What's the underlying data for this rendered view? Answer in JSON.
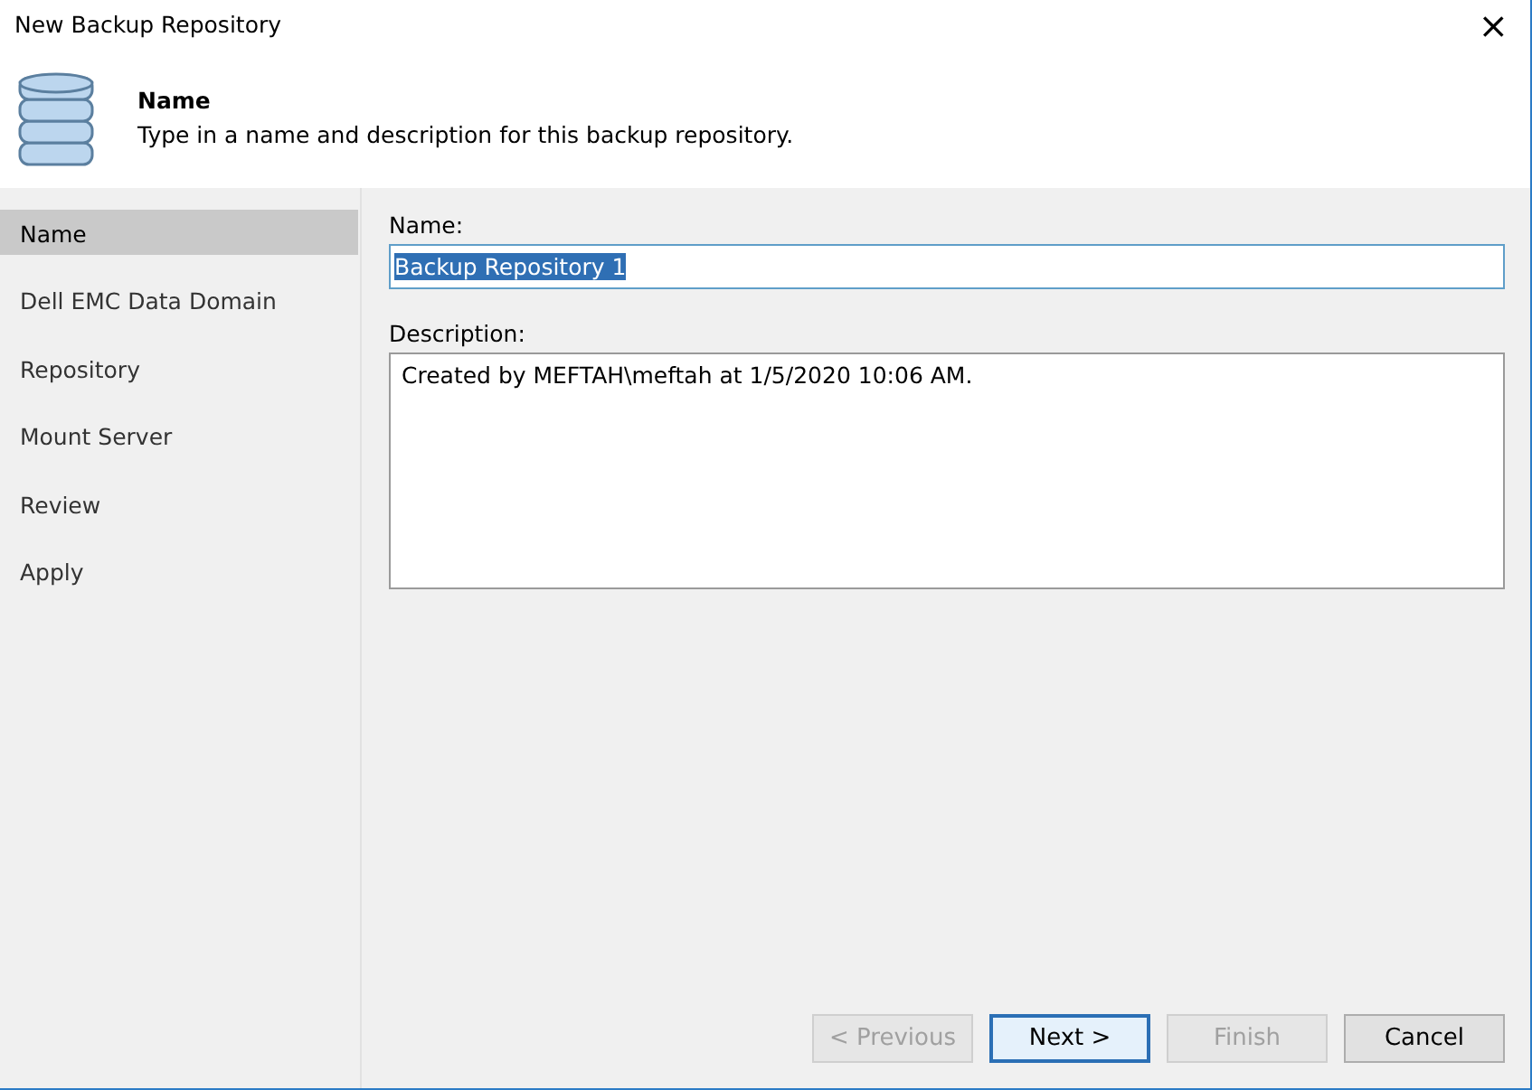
{
  "window": {
    "title": "New Backup Repository",
    "close": "×"
  },
  "header": {
    "title": "Name",
    "subtitle": "Type in a name and description for this backup repository."
  },
  "steps": [
    {
      "label": "Name",
      "selected": true
    },
    {
      "label": "Dell EMC Data Domain",
      "selected": false
    },
    {
      "label": "Repository",
      "selected": false
    },
    {
      "label": "Mount Server",
      "selected": false
    },
    {
      "label": "Review",
      "selected": false
    },
    {
      "label": "Apply",
      "selected": false
    }
  ],
  "name_field": {
    "label": "Name:",
    "value": "Backup Repository 1",
    "selected": true
  },
  "description_field": {
    "label": "Description:",
    "value": "Created by MEFTAH\\meftah at 1/5/2020 10:06 AM."
  },
  "buttons": [
    {
      "label": "< Previous",
      "disabled": true,
      "default": false
    },
    {
      "label": "Next >",
      "disabled": false,
      "default": true
    },
    {
      "label": "Finish",
      "disabled": true,
      "default": false
    },
    {
      "label": "Cancel",
      "disabled": false,
      "default": false
    }
  ]
}
